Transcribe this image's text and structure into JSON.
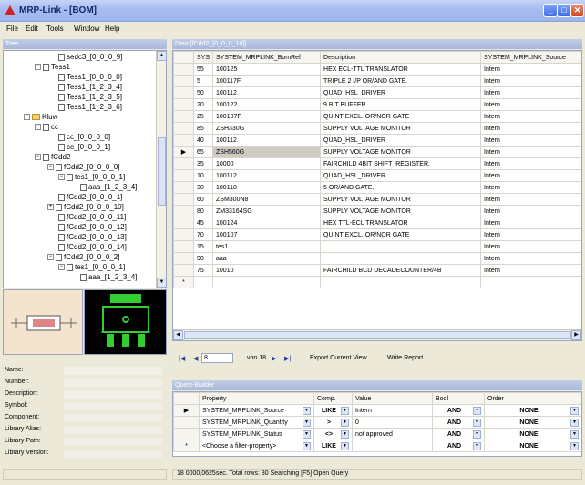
{
  "window": {
    "title": "MRP-Link - [BOM]",
    "app_icon": "app-logo-icon"
  },
  "menu": [
    "File",
    "Edit",
    "Tools",
    "Window",
    "Help"
  ],
  "tree_panel": {
    "title": "Tree",
    "nodes": [
      {
        "label": "sedc3_[0_0_0_9]",
        "kind": "doc",
        "indent": 60
      },
      {
        "label": "Tess1",
        "kind": "doc",
        "indent": 34,
        "expander": "−"
      },
      {
        "label": "Tess1_[0_0_0_0]",
        "kind": "doc",
        "indent": 60
      },
      {
        "label": "Tess1_[1_2_3_4]",
        "kind": "doc",
        "indent": 60
      },
      {
        "label": "Tess1_[1_2_3_5]",
        "kind": "doc",
        "indent": 60
      },
      {
        "label": "Tess1_[1_2_3_6]",
        "kind": "doc",
        "indent": 60
      },
      {
        "label": "Kluw",
        "kind": "folder",
        "indent": 22,
        "expander": "−"
      },
      {
        "label": "cc",
        "kind": "doc",
        "indent": 34,
        "expander": "−"
      },
      {
        "label": "cc_[0_0_0_0]",
        "kind": "doc",
        "indent": 60
      },
      {
        "label": "cc_[0_0_0_1]",
        "kind": "doc",
        "indent": 60
      },
      {
        "label": "fCdd2",
        "kind": "doc",
        "indent": 34,
        "expander": "−"
      },
      {
        "label": "fCdd2_[0_0_0_0]",
        "kind": "doc",
        "indent": 48,
        "expander": "−"
      },
      {
        "label": "tes1_[0_0_0_1]",
        "kind": "doc",
        "indent": 60,
        "expander": "−"
      },
      {
        "label": "aaa_[1_2_3_4]",
        "kind": "doc",
        "indent": 84
      },
      {
        "label": "fCdd2_[0_0_0_1]",
        "kind": "doc",
        "indent": 60
      },
      {
        "label": "fCdd2_[0_0_0_10]",
        "kind": "doc",
        "indent": 48,
        "expander": "+"
      },
      {
        "label": "fCdd2_[0_0_0_11]",
        "kind": "doc",
        "indent": 60
      },
      {
        "label": "fCdd2_[0_0_0_12]",
        "kind": "doc",
        "indent": 60
      },
      {
        "label": "fCdd2_[0_0_0_13]",
        "kind": "doc",
        "indent": 60
      },
      {
        "label": "fCdd2_[0_0_0_14]",
        "kind": "doc",
        "indent": 60
      },
      {
        "label": "fCdd2_[0_0_0_2]",
        "kind": "doc",
        "indent": 48,
        "expander": "−"
      },
      {
        "label": "tes1_[0_0_0_1]",
        "kind": "doc",
        "indent": 60,
        "expander": "−"
      },
      {
        "label": "aaa_[1_2_3_4]",
        "kind": "doc",
        "indent": 84
      }
    ]
  },
  "properties": {
    "labels": [
      "Name:",
      "Number:",
      "Description:",
      "Symbol:",
      "Component:",
      "Library Alias:",
      "Library Path:",
      "Library Version:"
    ]
  },
  "data_panel": {
    "title": "Data [fCdd2_[0_0_0_10]]",
    "columns": [
      "SYS",
      "SYSTEM_MRPLINK_BomRef",
      "Description",
      "SYSTEM_MRPLINK_Source"
    ],
    "rows": [
      {
        "sys": "55",
        "ref": "100125",
        "desc": "HEX ECL-TTL TRANSLATOR",
        "src": "Intern"
      },
      {
        "sys": "5",
        "ref": "100117F",
        "desc": "TRIPLE 2 I/P OR/AND GATE.",
        "src": "Intern"
      },
      {
        "sys": "50",
        "ref": "100112",
        "desc": "QUAD_HSL_DRIVER",
        "src": "Intern"
      },
      {
        "sys": "20",
        "ref": "100122",
        "desc": "9 BIT BUFFER.",
        "src": "Intern"
      },
      {
        "sys": "25",
        "ref": "100107F",
        "desc": "QUINT EXCL. OR/NOR GATE",
        "src": "Intern"
      },
      {
        "sys": "85",
        "ref": "ZSH330G",
        "desc": "SUPPLY VOLTAGE MONITOR",
        "src": "Intern"
      },
      {
        "sys": "40",
        "ref": "100112",
        "desc": "QUAD_HSL_DRIVER",
        "src": "Intern"
      },
      {
        "sys": "65",
        "ref": "ZSH560G",
        "desc": "SUPPLY VOLTAGE MONITOR",
        "src": "Intern",
        "current": true
      },
      {
        "sys": "35",
        "ref": "10000",
        "desc": "FAIRCHILD 4BIT SHIFT_REGISTER.",
        "src": "Intern"
      },
      {
        "sys": "10",
        "ref": "100112",
        "desc": "QUAD_HSL_DRIVER",
        "src": "Intern"
      },
      {
        "sys": "30",
        "ref": "100118",
        "desc": "5 OR/AND GATE.",
        "src": "Intern"
      },
      {
        "sys": "60",
        "ref": "ZSM300N8",
        "desc": "SUPPLY VOLTAGE MONITOR",
        "src": "Intern"
      },
      {
        "sys": "80",
        "ref": "ZM33164SG",
        "desc": "SUPPLY VOLTAGE MONITOR",
        "src": "Intern"
      },
      {
        "sys": "45",
        "ref": "100124",
        "desc": "HEX TTL-ECL TRANSLATOR",
        "src": "Intern"
      },
      {
        "sys": "70",
        "ref": "100107",
        "desc": "QUINT EXCL. OR/NOR GATE",
        "src": "Intern"
      },
      {
        "sys": "15",
        "ref": "tes1",
        "desc": "",
        "src": "Intern"
      },
      {
        "sys": "90",
        "ref": "aaa",
        "desc": "",
        "src": "Intern"
      },
      {
        "sys": "75",
        "ref": "10010",
        "desc": "FAIRCHILD BCD DECADECOUNTER/4B",
        "src": "Intern"
      }
    ],
    "new_row_marker": "*",
    "current_row_marker": "▶"
  },
  "navigator": {
    "page": "8",
    "of_label": "von 18",
    "export_label": "Export Current View",
    "report_label": "Write Report"
  },
  "query_panel": {
    "title": "Query-Builder",
    "columns": [
      "Property",
      "Comp.",
      "Value",
      "Bool",
      "Order"
    ],
    "rows": [
      {
        "marker": "▶",
        "property": "SYSTEM_MRPLINK_Source",
        "comp": "LIKE",
        "value": "Intern",
        "bool": "AND",
        "order": "NONE"
      },
      {
        "marker": "",
        "property": "SYSTEM_MRPLINK_Quantity",
        "comp": ">",
        "value": "0",
        "bool": "AND",
        "order": "NONE"
      },
      {
        "marker": "",
        "property": "SYSTEM_MRPLINK_Status",
        "comp": "<>",
        "value": "not approved",
        "bool": "AND",
        "order": "NONE"
      },
      {
        "marker": "*",
        "property": "<Choose a filter-property>",
        "comp": "LIKE",
        "value": "",
        "bool": "AND",
        "order": "NONE"
      }
    ]
  },
  "status": {
    "text": "18  0000,0625sec.  Total rows: 30  Searching [F5]  Open Query"
  },
  "colors": {
    "title_bar": "#a9bdf0",
    "panel_title": "#b4c2e0",
    "selected_cell": "#cdcbc2",
    "thumb_bg": "#f4e3ce",
    "pcb_bg": "#000000",
    "pcb_green": "#33cc33"
  }
}
